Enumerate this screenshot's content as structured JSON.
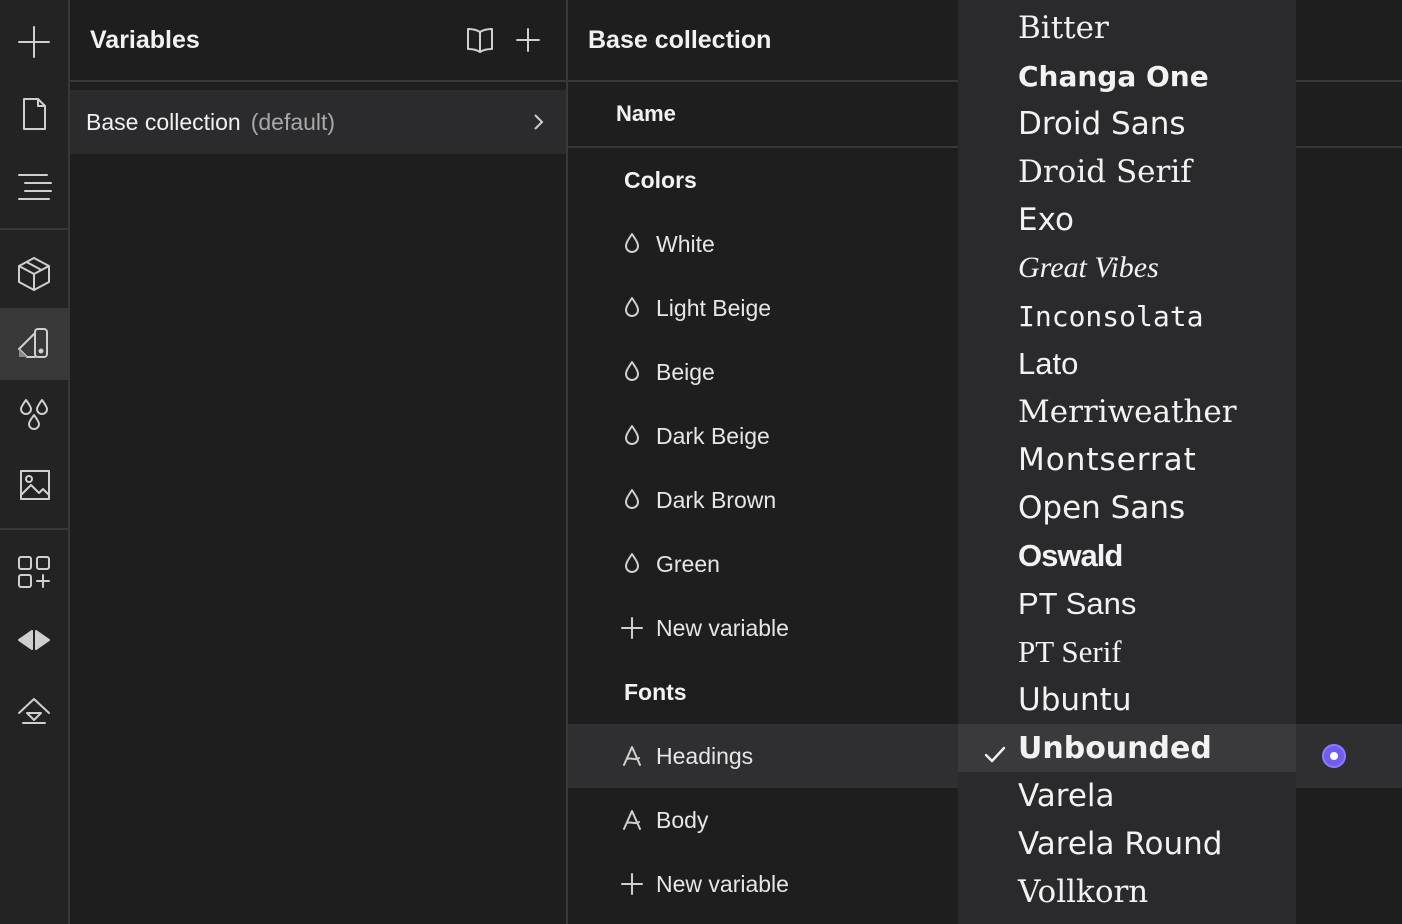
{
  "rail": {
    "items": [
      {
        "icon": "plus-icon"
      },
      {
        "icon": "page-icon"
      },
      {
        "icon": "navigator-icon"
      },
      {
        "icon": "components-icon"
      },
      {
        "icon": "styles-icon"
      },
      {
        "icon": "variables-icon"
      },
      {
        "icon": "assets-icon"
      },
      {
        "icon": "apps-icon"
      },
      {
        "icon": "interactions-icon"
      },
      {
        "icon": "publish-icon"
      }
    ]
  },
  "variables_panel": {
    "title": "Variables",
    "collection": {
      "name": "Base collection",
      "default_label": "(default)"
    }
  },
  "detail": {
    "title": "Base collection",
    "column_header": "Name",
    "groups": [
      {
        "label": "Colors",
        "items": [
          "White",
          "Light Beige",
          "Beige",
          "Dark Beige",
          "Dark Brown",
          "Green"
        ],
        "new_label": "New variable"
      },
      {
        "label": "Fonts",
        "items": [
          "Headings",
          "Body"
        ],
        "new_label": "New variable"
      }
    ],
    "selected_item": "Headings",
    "accent": "#6f5ef0"
  },
  "font_dropdown": {
    "options": [
      "Bitter",
      "Changa One",
      "Droid Sans",
      "Droid Serif",
      "Exo",
      "Great Vibes",
      "Inconsolata",
      "Lato",
      "Merriweather",
      "Montserrat",
      "Open Sans",
      "Oswald",
      "PT Sans",
      "PT Serif",
      "Ubuntu",
      "Unbounded",
      "Varela",
      "Varela Round",
      "Vollkorn"
    ],
    "selected": "Unbounded"
  }
}
